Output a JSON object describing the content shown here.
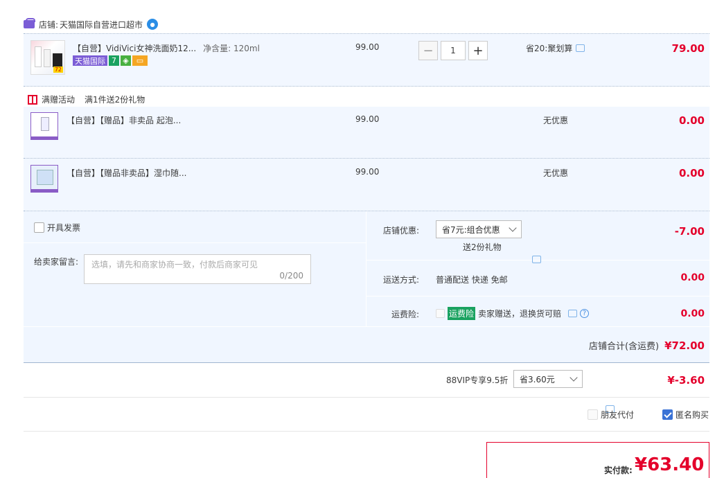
{
  "shop": {
    "label": "店铺:",
    "name": "天猫国际自营进口超市"
  },
  "items": [
    {
      "title": "【自营】VidiVici女神洗面奶12...",
      "spec": "净含量: 120ml",
      "price": "99.00",
      "quantity": "1",
      "promo": "省20:聚划算",
      "subtotal": "79.00"
    },
    {
      "title": "【自营】【赠品】非卖品 起泡...",
      "price": "99.00",
      "promo": "无优惠",
      "subtotal": "0.00"
    },
    {
      "title": "【自营】【赠品非卖品】湿巾随...",
      "price": "99.00",
      "promo": "无优惠",
      "subtotal": "0.00"
    }
  ],
  "tags": {
    "tmall_intl": "天猫国际",
    "seven": "7"
  },
  "gift": {
    "label": "满赠活动",
    "desc": "满1件送2份礼物"
  },
  "invoice": {
    "label": "开具发票"
  },
  "message": {
    "label": "给卖家留言:",
    "placeholder": "选填，请先和商家协商一致，付款后商家可见",
    "count": "0/200"
  },
  "store_discount": {
    "label": "店铺优惠:",
    "selected": "省7元:组合优惠",
    "note": "送2份礼物",
    "amount": "-7.00"
  },
  "shipping": {
    "label": "运送方式:",
    "value": "普通配送 快递 免邮",
    "amount": "0.00"
  },
  "insurance": {
    "label": "运费险:",
    "badge": "运费险",
    "desc": "卖家赠送，退换货可赔",
    "amount": "0.00"
  },
  "store_total": {
    "label": "店铺合计(含运费)",
    "amount": "¥72.00"
  },
  "vip": {
    "label": "88VIP专享9.5折",
    "selected": "省3.60元",
    "amount": "¥-3.60"
  },
  "options": {
    "friend_pay": "朋友代付",
    "anonymous": "匿名购买"
  },
  "payment": {
    "label": "实付款:",
    "amount": "¥63.40"
  },
  "colors": {
    "price_red": "#e4002b",
    "accent_blue": "#3b73d6",
    "row_bg": "#f2f7ff",
    "tmall_purple": "#7b5dd6",
    "insurance_green": "#1aa260"
  }
}
